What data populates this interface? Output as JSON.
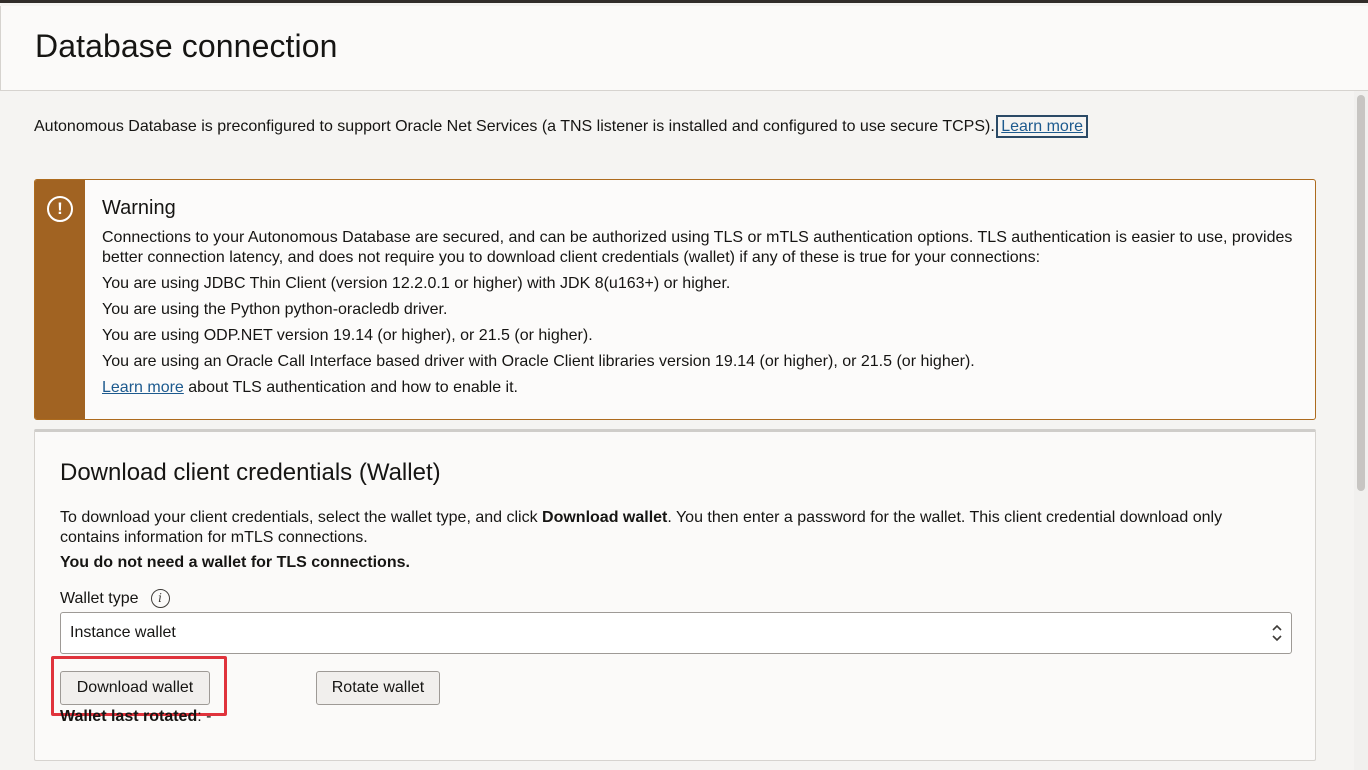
{
  "page": {
    "title": "Database connection"
  },
  "intro": {
    "text": "Autonomous Database is preconfigured to support Oracle Net Services (a TNS listener is installed and configured to use secure TCPS).",
    "link": "Learn more"
  },
  "warning": {
    "icon": "exclamation-circle-icon",
    "title": "Warning",
    "lines": [
      "Connections to your Autonomous Database are secured, and can be authorized using TLS or mTLS authentication options. TLS authentication is easier to use, provides better connection latency, and does not require you to download client credentials (wallet) if any of these is true for your connections:",
      "You are using JDBC Thin Client (version 12.2.0.1 or higher) with JDK 8(u163+) or higher.",
      "You are using the Python python-oracledb driver.",
      "You are using ODP.NET version 19.14 (or higher), or 21.5 (or higher).",
      "You are using an Oracle Call Interface based driver with Oracle Client libraries version 19.14 (or higher), or 21.5 (or higher)."
    ],
    "footer_link": "Learn more",
    "footer_text": " about TLS authentication and how to enable it.",
    "accent_color": "#a16322"
  },
  "credentials": {
    "title": "Download client credentials (Wallet)",
    "desc_part1": "To download your client credentials, select the wallet type, and click ",
    "desc_bold": "Download wallet",
    "desc_part2": ". You then enter a password for the wallet. This client credential download only contains information for mTLS connections.",
    "note": "You do not need a wallet for TLS connections.",
    "wallet_type_label": "Wallet type",
    "wallet_type_value": "Instance wallet",
    "download_button": "Download wallet",
    "rotate_button": "Rotate wallet",
    "last_rotated_label": "Wallet last rotated",
    "last_rotated_value": ": -",
    "highlight_color": "#e0333c"
  }
}
